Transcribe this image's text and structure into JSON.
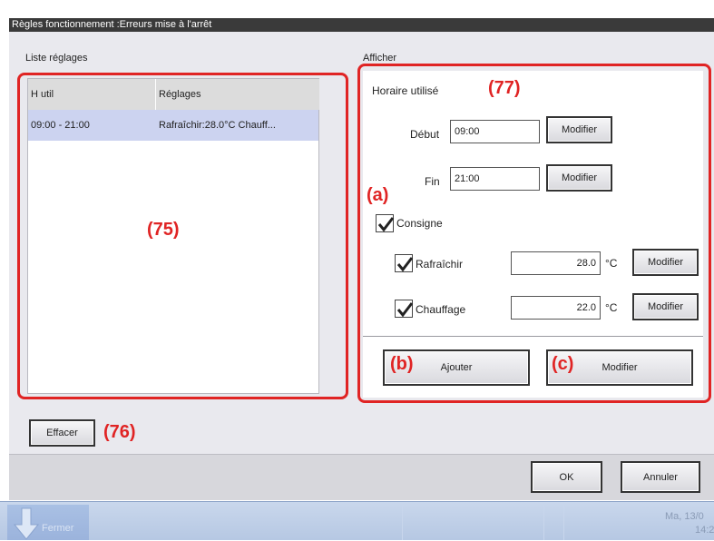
{
  "window": {
    "title": "Règles fonctionnement :Erreurs mise à l'arrêt"
  },
  "list": {
    "section_label": "Liste réglages",
    "columns": [
      "H util",
      "Réglages"
    ],
    "rows": [
      {
        "time": "09:00 - 21:00",
        "settings": "Rafraîchir:28.0°C Chauff..."
      }
    ],
    "delete_label": "Effacer"
  },
  "display": {
    "section_label": "Afficher",
    "schedule_label": "Horaire utilisé",
    "start_label": "Début",
    "start_value": "09:00",
    "end_label": "Fin",
    "end_value": "21:00",
    "modify_label": "Modifier",
    "setpoint_label": "Consigne",
    "setpoint_checked": true,
    "cool_label": "Rafraîchir",
    "cool_checked": true,
    "cool_value": "28.0",
    "heat_label": "Chauffage",
    "heat_checked": true,
    "heat_value": "22.0",
    "unit": "°C",
    "add_label": "Ajouter",
    "apply_label": "Modifier"
  },
  "annotations": {
    "a": "(a)",
    "b": "(b)",
    "c": "(c)",
    "n75": "(75)",
    "n76": "(76)",
    "n77": "(77)",
    "color": "#e02424"
  },
  "footer": {
    "ok_label": "OK",
    "cancel_label": "Annuler"
  },
  "taskbar": {
    "start_label": "Fermer",
    "date": "Ma, 13/0",
    "time": "14:2"
  }
}
